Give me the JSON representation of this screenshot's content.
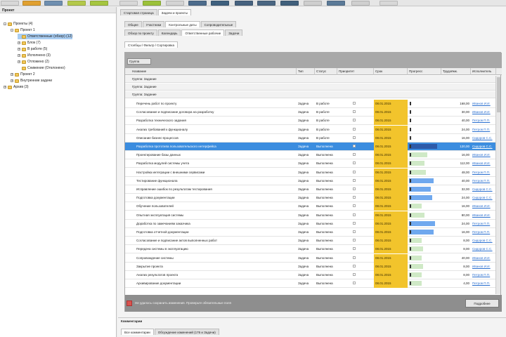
{
  "toolbar": {
    "buttons": [
      {
        "name": "tb-btn-1",
        "color": "#d8d8d8"
      },
      {
        "name": "tb-btn-2",
        "color": "#e0a030"
      },
      {
        "name": "tb-btn-3",
        "color": "#6f8fb0"
      },
      {
        "name": "tb-btn-4",
        "color": "#b4c94a"
      },
      {
        "name": "tb-btn-5",
        "color": "#a6c640"
      },
      {
        "name": "tb-btn-6",
        "color": "#d8d8d8"
      },
      {
        "name": "tb-btn-7",
        "color": "#9cc23a"
      },
      {
        "name": "tb-btn-8",
        "color": "#d4d4d4"
      },
      {
        "name": "tb-btn-9",
        "color": "#4d6c8c"
      },
      {
        "name": "tb-btn-10",
        "color": "#3f607e"
      },
      {
        "name": "tb-btn-11",
        "color": "#46627f"
      },
      {
        "name": "tb-btn-12",
        "color": "#4a6682"
      },
      {
        "name": "tb-btn-13",
        "color": "#41607c"
      },
      {
        "name": "tb-btn-14",
        "color": "#cfcfcf"
      },
      {
        "name": "tb-btn-15",
        "color": "#5b7a98"
      },
      {
        "name": "tb-btn-16",
        "color": "#d0d0d0"
      },
      {
        "name": "tb-btn-17",
        "color": "#d8d8d8"
      }
    ]
  },
  "tree": {
    "header": "Проект",
    "items": [
      {
        "label": "Проекты (4)",
        "level": 0,
        "expander": "-",
        "selected": false
      },
      {
        "label": "Проект 1",
        "level": 1,
        "expander": "-",
        "selected": false
      },
      {
        "label": "Ответственные (обзор) (12)",
        "level": 2,
        "expander": "",
        "selected": true
      },
      {
        "label": "Блок (7)",
        "level": 2,
        "expander": "+",
        "selected": false
      },
      {
        "label": "В работе (5)",
        "level": 2,
        "expander": "+",
        "selected": false
      },
      {
        "label": "Исполнено (3)",
        "level": 2,
        "expander": "+",
        "selected": false
      },
      {
        "label": "Отложено (2)",
        "level": 2,
        "expander": "+",
        "selected": false
      },
      {
        "label": "Снижение (Отклонено)",
        "level": 2,
        "expander": "",
        "selected": false
      },
      {
        "label": "Проект 2",
        "level": 1,
        "expander": "+",
        "selected": false
      },
      {
        "label": "Внутренние задачи",
        "level": 1,
        "expander": "+",
        "selected": false
      },
      {
        "label": "Архив (3)",
        "level": 0,
        "expander": "+",
        "selected": false
      }
    ]
  },
  "tabs_row1": [
    "Стартовая страница",
    "Задачи и проекты"
  ],
  "tabs_row2": [
    "Общее",
    "Участники",
    "Контрольные даты",
    "Сопроводительные"
  ],
  "tabs_row3": [
    "Обзор по проекту",
    "Календарь",
    "Ответственные рабочие",
    "Задачи"
  ],
  "tabs_row4": [
    "Столбцы / Фильтр / Сортировка"
  ],
  "grid": {
    "group_chip": "Группа",
    "columns": [
      "Название",
      "Тип",
      "Статус",
      "Приоритет",
      "Срок",
      "Прогресс",
      "Трудоёмк.",
      "Исполнитель"
    ],
    "groups": [
      "Группа: Задание",
      "Группа: Задание",
      "Группа: Задание"
    ],
    "rows": [
      {
        "name": "Перечень работ по проекту",
        "type": "Задача",
        "status": "В работе",
        "date": "08.01.2015",
        "progress": 0,
        "pcolor": "#f5f5f5",
        "hours": "168,00",
        "user": "Иванов И.И.",
        "sel": false
      },
      {
        "name": "Согласование и подписание договора на разработку",
        "type": "Задача",
        "status": "В работе",
        "date": "08.01.2015",
        "progress": 0,
        "pcolor": "#f5f5f5",
        "hours": "30,00",
        "user": "Иванов И.И.",
        "sel": false
      },
      {
        "name": "Разработка технического задания",
        "type": "Задача",
        "status": "В работе",
        "date": "08.01.2015",
        "progress": 0,
        "pcolor": "#f5f5f5",
        "hours": "40,00",
        "user": "Петров П.П.",
        "sel": false
      },
      {
        "name": "Анализ требований к функционалу",
        "type": "Задача",
        "status": "В работе",
        "date": "08.01.2015",
        "progress": 0,
        "pcolor": "#f5f5f5",
        "hours": "24,00",
        "user": "Петров П.П.",
        "sel": false
      },
      {
        "name": "Описание бизнес-процессов",
        "type": "Задача",
        "status": "В работе",
        "date": "08.01.2015",
        "progress": 0.1,
        "pcolor": "#f5f5f5",
        "hours": "16,00",
        "user": "Сидоров С.С.",
        "sel": false
      },
      {
        "name": "Разработка прототипа пользовательского интерфейса",
        "type": "Задача",
        "status": "Выполнена",
        "date": "08.01.2015",
        "progress": 0.9,
        "pcolor": "#2c5aa8",
        "hours": "120,00",
        "user": "Сидоров С.С.",
        "sel": true
      },
      {
        "name": "Проектирование базы данных",
        "type": "Задача",
        "status": "Выполнена",
        "date": "08.01.2015",
        "progress": 0.6,
        "pcolor": "#cfe9c6",
        "hours": "16,00",
        "user": "Иванов И.И.",
        "sel": false
      },
      {
        "name": "Разработка модулей системы учета",
        "type": "Задача",
        "status": "Выполнена",
        "date": "08.01.2015",
        "progress": 0.5,
        "pcolor": "#cfe9c6",
        "hours": "112,00",
        "user": "Иванов И.И.",
        "sel": false
      },
      {
        "name": "Настройка интеграции с внешними сервисами",
        "type": "Задача",
        "status": "Выполнена",
        "date": "08.01.2015",
        "progress": 0.55,
        "pcolor": "#cfe9c6",
        "hours": "48,00",
        "user": "Петров П.П.",
        "sel": false
      },
      {
        "name": "Тестирование функционала",
        "type": "Задача",
        "status": "Выполнена",
        "date": "08.01.2015",
        "progress": 0.8,
        "pcolor": "#6fa8ee",
        "hours": "40,00",
        "user": "Петров П.П.",
        "sel": false
      },
      {
        "name": "Исправление ошибок по результатам тестирования",
        "type": "Задача",
        "status": "Выполнена",
        "date": "08.01.2015",
        "progress": 0.7,
        "pcolor": "#6fa8ee",
        "hours": "32,00",
        "user": "Сидоров С.С.",
        "sel": false
      },
      {
        "name": "Подготовка документации",
        "type": "Задача",
        "status": "Выполнена",
        "date": "08.01.2015",
        "progress": 0.75,
        "pcolor": "#6fa8ee",
        "hours": "24,00",
        "user": "Сидоров С.С.",
        "sel": false
      },
      {
        "name": "Обучение пользователей",
        "type": "Задача",
        "status": "Выполнена",
        "date": "08.01.2015",
        "progress": 0.4,
        "pcolor": "#cfe9c6",
        "hours": "16,00",
        "user": "Иванов И.И.",
        "sel": false
      },
      {
        "name": "Опытная эксплуатация системы",
        "type": "Задача",
        "status": "Выполнена",
        "date": "08.01.2015",
        "progress": 0.5,
        "pcolor": "#cfe9c6",
        "hours": "80,00",
        "user": "Иванов И.И.",
        "sel": false
      },
      {
        "name": "Доработка по замечаниям заказчика",
        "type": "Задача",
        "status": "Выполнена",
        "date": "08.01.2015",
        "progress": 0.85,
        "pcolor": "#6fa8ee",
        "hours": "24,00",
        "user": "Петров П.П.",
        "sel": false
      },
      {
        "name": "Подготовка отчетной документации",
        "type": "Задача",
        "status": "Выполнена",
        "date": "08.01.2015",
        "progress": 0.8,
        "pcolor": "#6fa8ee",
        "hours": "16,00",
        "user": "Петров П.П.",
        "sel": false
      },
      {
        "name": "Согласование и подписание актов выполненных работ",
        "type": "Задача",
        "status": "Выполнена",
        "date": "08.01.2015",
        "progress": 0.4,
        "pcolor": "#cfe9c6",
        "hours": "8,00",
        "user": "Сидоров С.С.",
        "sel": false
      },
      {
        "name": "Передача системы в эксплуатацию",
        "type": "Задача",
        "status": "Выполнена",
        "date": "08.01.2015",
        "progress": 0.45,
        "pcolor": "#cfe9c6",
        "hours": "8,00",
        "user": "Сидоров С.С.",
        "sel": false
      },
      {
        "name": "Сопровождение системы",
        "type": "Задача",
        "status": "Выполнена",
        "date": "08.01.2015",
        "progress": 0.4,
        "pcolor": "#cfe9c6",
        "hours": "40,00",
        "user": "Иванов И.И.",
        "sel": false
      },
      {
        "name": "Закрытие проекта",
        "type": "Задача",
        "status": "Выполнена",
        "date": "08.01.2015",
        "progress": 0.45,
        "pcolor": "#cfe9c6",
        "hours": "8,00",
        "user": "Иванов И.И.",
        "sel": false
      },
      {
        "name": "Анализ результатов проекта",
        "type": "Задача",
        "status": "Выполнена",
        "date": "08.01.2015",
        "progress": 0.4,
        "pcolor": "#cfe9c6",
        "hours": "8,00",
        "user": "Петров П.П.",
        "sel": false
      },
      {
        "name": "Архивирование документации",
        "type": "Задача",
        "status": "Выполнена",
        "date": "08.01.2015",
        "progress": 0.4,
        "pcolor": "#cfe9c6",
        "hours": "4,00",
        "user": "Петров П.П.",
        "sel": false
      }
    ]
  },
  "status": {
    "text": "Не удалось сохранить изменения. Проверьте обязательные поля",
    "button": "Подробнее"
  },
  "bottom": {
    "title": "Комментарии",
    "tabs": [
      "Все комментарии",
      "Обсуждение изменений (176 и Задачи)"
    ]
  }
}
